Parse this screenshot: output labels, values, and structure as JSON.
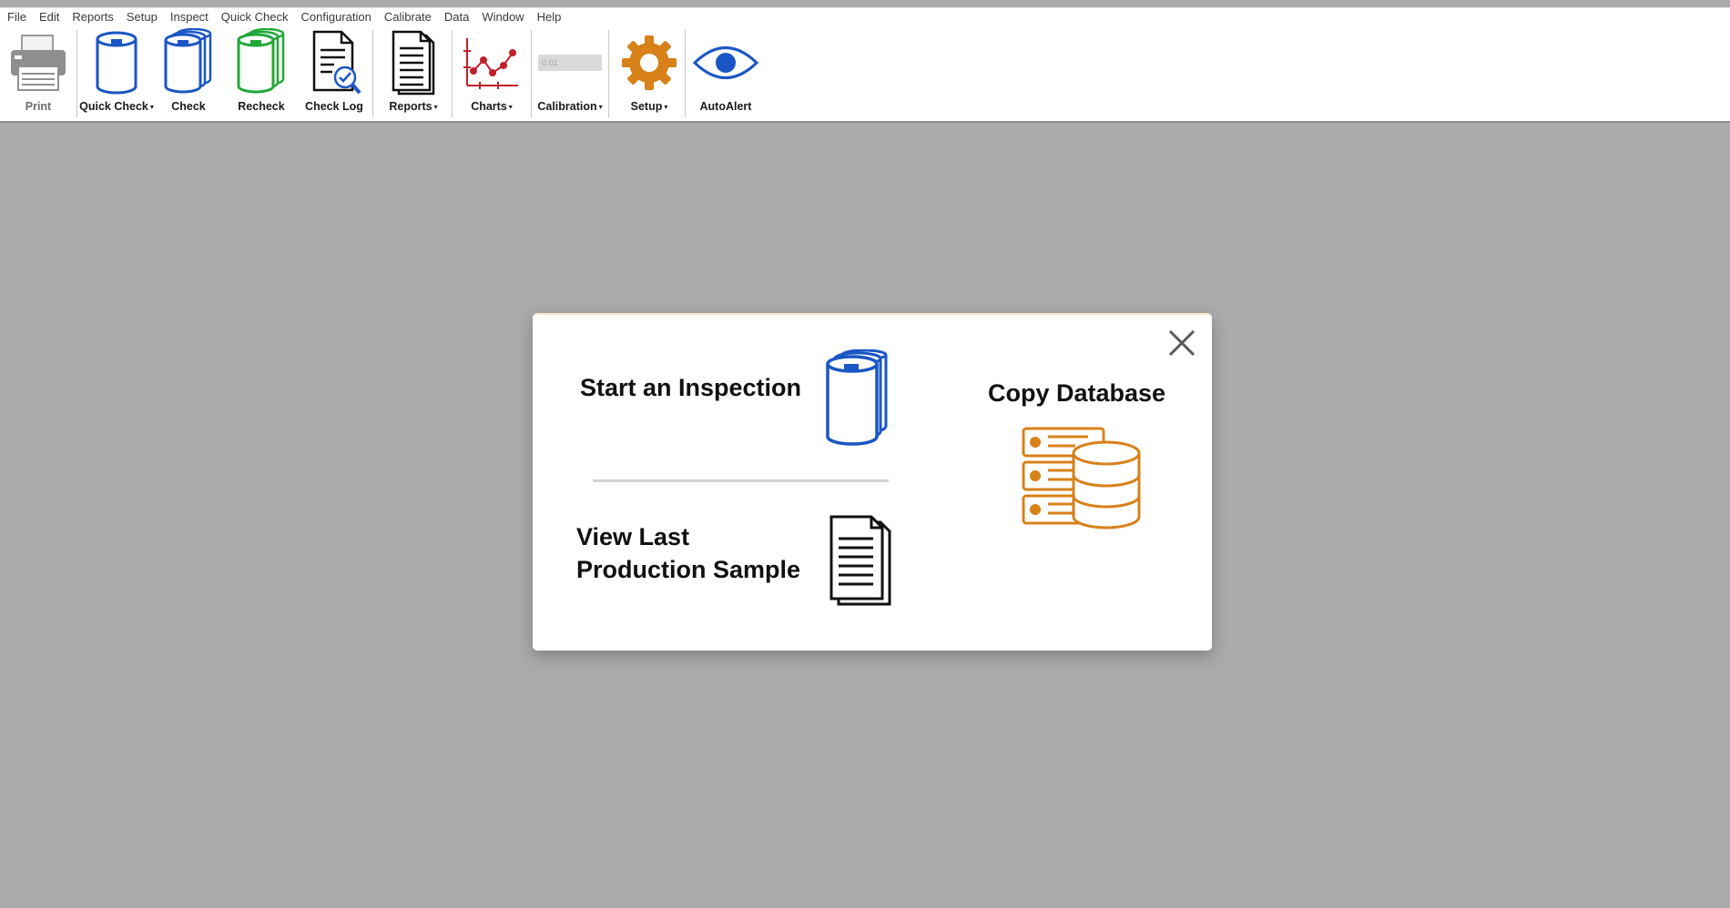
{
  "menu": [
    "File",
    "Edit",
    "Reports",
    "Setup",
    "Inspect",
    "Quick Check",
    "Configuration",
    "Calibrate",
    "Data",
    "Window",
    "Help"
  ],
  "toolbar": {
    "print": "Print",
    "quick_check": "Quick Check",
    "check": "Check",
    "recheck": "Recheck",
    "check_log": "Check Log",
    "reports": "Reports",
    "charts": "Charts",
    "calibration": "Calibration",
    "calibration_field": "0.01",
    "setup": "Setup",
    "autoalert": "AutoAlert",
    "dropdown_caret": "▾"
  },
  "dialog": {
    "start_inspection": "Start an Inspection",
    "view_last_line1": "View Last",
    "view_last_line2": "Production Sample",
    "copy_database": "Copy Database"
  },
  "colors": {
    "background": "#ababab",
    "blue": "#1a56c4",
    "green": "#22a839",
    "orange": "#d88119",
    "red": "#c21f2c"
  }
}
